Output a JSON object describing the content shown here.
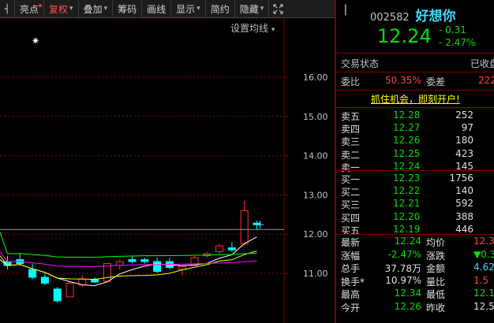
{
  "toolbar": {
    "collapse_icon": "chevron-left-icon",
    "items": [
      {
        "label": "亮点",
        "dot": true
      },
      {
        "label": "复权",
        "active": true,
        "arrow": true
      },
      {
        "label": "叠加",
        "arrow": true
      },
      {
        "label": "筹码"
      },
      {
        "label": "画线"
      },
      {
        "label": "显示",
        "arrow": true
      },
      {
        "label": "简约"
      },
      {
        "label": "隐藏",
        "arrow": true
      }
    ],
    "expand_icon": "fullscreen-icon"
  },
  "chart": {
    "ma_setting": "设置均线",
    "marker": "✷",
    "price_labels": [
      "16.00",
      "15.00",
      "14.00",
      "13.00",
      "12.00",
      "11.00"
    ],
    "colors": {
      "up": "#ff3030",
      "down": "#00ffff",
      "ma1": "#ffffff",
      "ma2": "#ffff00",
      "ma3": "#ff00ff",
      "ma4": "#00ff00"
    }
  },
  "chart_data": {
    "type": "candlestick",
    "ylim": [
      10.2,
      16.6
    ],
    "candles": [
      {
        "o": 11.3,
        "h": 11.45,
        "l": 11.1,
        "c": 11.2
      },
      {
        "o": 11.35,
        "h": 11.5,
        "l": 11.2,
        "c": 11.25
      },
      {
        "o": 11.1,
        "h": 11.25,
        "l": 10.85,
        "c": 10.9
      },
      {
        "o": 10.9,
        "h": 11.0,
        "l": 10.7,
        "c": 10.75
      },
      {
        "o": 10.6,
        "h": 10.65,
        "l": 10.25,
        "c": 10.3
      },
      {
        "o": 10.4,
        "h": 10.8,
        "l": 10.4,
        "c": 10.75
      },
      {
        "o": 10.7,
        "h": 10.95,
        "l": 10.65,
        "c": 10.85
      },
      {
        "o": 10.85,
        "h": 10.9,
        "l": 10.75,
        "c": 10.78
      },
      {
        "o": 10.8,
        "h": 11.25,
        "l": 10.75,
        "c": 11.25
      },
      {
        "o": 11.2,
        "h": 11.35,
        "l": 11.1,
        "c": 11.3
      },
      {
        "o": 11.35,
        "h": 11.45,
        "l": 11.25,
        "c": 11.3
      },
      {
        "o": 11.35,
        "h": 11.4,
        "l": 11.25,
        "c": 11.3
      },
      {
        "o": 11.3,
        "h": 11.4,
        "l": 11.0,
        "c": 11.05
      },
      {
        "o": 11.3,
        "h": 11.4,
        "l": 11.1,
        "c": 11.15
      },
      {
        "o": 11.1,
        "h": 11.2,
        "l": 10.95,
        "c": 11.18
      },
      {
        "o": 11.2,
        "h": 11.45,
        "l": 11.2,
        "c": 11.4
      },
      {
        "o": 11.45,
        "h": 11.55,
        "l": 11.4,
        "c": 11.5
      },
      {
        "o": 11.55,
        "h": 11.75,
        "l": 11.5,
        "c": 11.7
      },
      {
        "o": 11.65,
        "h": 11.8,
        "l": 11.55,
        "c": 11.6
      },
      {
        "o": 11.75,
        "h": 12.85,
        "l": 11.7,
        "c": 12.6
      },
      {
        "o": 12.28,
        "h": 12.34,
        "l": 12.1,
        "c": 12.24
      }
    ]
  },
  "quote": {
    "code": "002582",
    "name": "好想你",
    "price": "12.24",
    "change": "- 0.31",
    "change_pct": "- 2.47%"
  },
  "status": {
    "label": "交易状态",
    "value": "已收盘"
  },
  "ratio": {
    "wb_label": "委比",
    "wb_value": "50.35%",
    "wc_label": "委差",
    "wc_value": "222"
  },
  "promo": "抓住机会，即刻开户!",
  "asks": [
    {
      "label": "卖五",
      "price": "12.28",
      "vol": "252"
    },
    {
      "label": "卖四",
      "price": "12.27",
      "vol": "97"
    },
    {
      "label": "卖三",
      "price": "12.26",
      "vol": "180"
    },
    {
      "label": "卖二",
      "price": "12.25",
      "vol": "423"
    },
    {
      "label": "卖一",
      "price": "12.24",
      "vol": "145"
    }
  ],
  "bids": [
    {
      "label": "买一",
      "price": "12.23",
      "vol": "1756"
    },
    {
      "label": "买二",
      "price": "12.22",
      "vol": "140"
    },
    {
      "label": "买三",
      "price": "12.21",
      "vol": "592"
    },
    {
      "label": "买四",
      "price": "12.20",
      "vol": "388"
    },
    {
      "label": "买五",
      "price": "12.19",
      "vol": "446"
    }
  ],
  "stats": [
    {
      "l1": "最新",
      "v1": "12.24",
      "c1": "green",
      "l2": "均价",
      "v2": "12.3",
      "c2": "red"
    },
    {
      "l1": "涨幅",
      "v1": "-2.47%",
      "c1": "green",
      "l2": "涨跌",
      "v2": "▼0.3",
      "c2": "green"
    },
    {
      "l1": "总手",
      "v1": "37.78万",
      "c1": "white",
      "l2": "金额",
      "v2": "4.62",
      "c2": "cyan"
    },
    {
      "l1": "换手*",
      "v1": "10.97%",
      "c1": "white",
      "l2": "量比",
      "v2": "1.5",
      "c2": "red"
    },
    {
      "l1": "最高",
      "v1": "12.34",
      "c1": "green",
      "l2": "最低",
      "v2": "12.1",
      "c2": "green"
    },
    {
      "l1": "今开",
      "v1": "12.26",
      "c1": "green",
      "l2": "昨收",
      "v2": "12.5",
      "c2": "white"
    }
  ]
}
